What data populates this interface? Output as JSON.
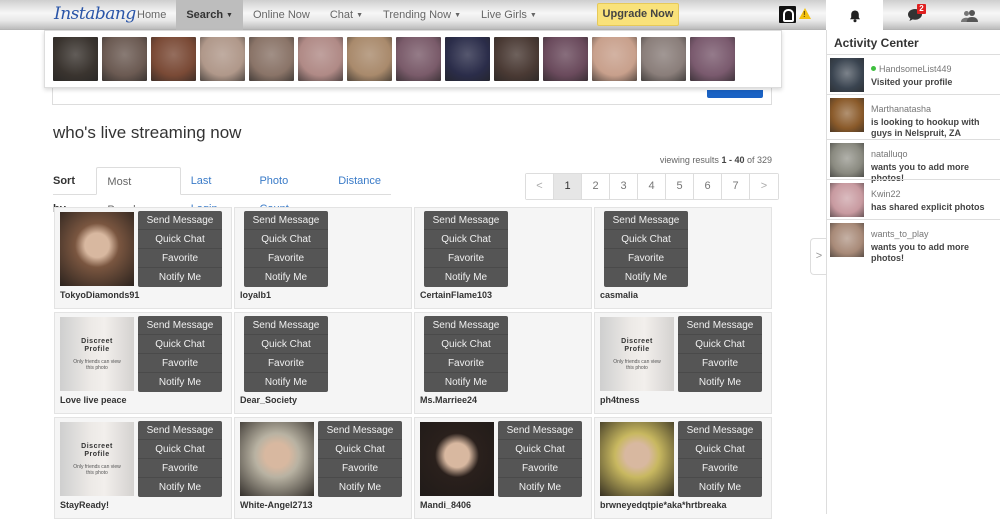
{
  "header": {
    "logo_text": "Instabang",
    "nav": [
      {
        "label": "Home",
        "dropdown": false,
        "active": false
      },
      {
        "label": "Search",
        "dropdown": true,
        "active": true
      },
      {
        "label": "Online Now",
        "dropdown": false,
        "active": false
      },
      {
        "label": "Chat",
        "dropdown": true,
        "active": false
      },
      {
        "label": "Trending Now",
        "dropdown": true,
        "active": false
      },
      {
        "label": "Live Girls",
        "dropdown": true,
        "active": false
      }
    ],
    "upgrade_label": "Upgrade Now",
    "warning_glyph": "!",
    "messages_badge": "2",
    "icons": [
      "profile-avatar-icon",
      "warning-icon",
      "bell-icon",
      "chat-bubble-icon",
      "friends-icon"
    ]
  },
  "photo_strip": {
    "colors": [
      "#3a342f",
      "#6b5a52",
      "#7a4a36",
      "#b0988a",
      "#8a7468",
      "#b08a86",
      "#a98a6c",
      "#7a5b6a",
      "#2b2d4a",
      "#4a3a34",
      "#6a4a5c",
      "#c8a08c",
      "#8a7e7a",
      "#7a5a6e"
    ]
  },
  "search": {
    "button_color": "#1a62c4"
  },
  "main": {
    "title": "who's live streaming now",
    "sort": {
      "label": "Sort by",
      "tabs": [
        {
          "label": "Most Popular",
          "active": true
        },
        {
          "label": "Last Login",
          "active": false
        },
        {
          "label": "Photo Count",
          "active": false
        },
        {
          "label": "Distance",
          "active": false
        }
      ]
    },
    "viewing": {
      "prefix": "viewing results ",
      "range": "1 - 40",
      "middle": " of ",
      "total": "329"
    },
    "pagination": {
      "prev": "<",
      "next": ">",
      "pages": [
        "1",
        "2",
        "3",
        "4",
        "5",
        "6",
        "7"
      ],
      "current": "1"
    },
    "discreet": {
      "title_line1": "Discreet",
      "title_line2": "Profile",
      "note": "Only friends can view this photo"
    },
    "actions": [
      "Send Message",
      "Quick Chat",
      "Favorite",
      "Notify Me"
    ],
    "members": [
      {
        "username": "TokyoDiamonds91",
        "photo": "photo",
        "color": "#7a5640"
      },
      {
        "username": "loyalb1",
        "photo": "none",
        "color": ""
      },
      {
        "username": "CertainFlame103",
        "photo": "none",
        "color": ""
      },
      {
        "username": "casmalia",
        "photo": "none",
        "color": ""
      },
      {
        "username": "Love live peace",
        "photo": "discreet",
        "color": ""
      },
      {
        "username": "Dear_Society",
        "photo": "none",
        "color": ""
      },
      {
        "username": "Ms.Marriee24",
        "photo": "none",
        "color": ""
      },
      {
        "username": "ph4tness",
        "photo": "discreet",
        "color": ""
      },
      {
        "username": "StayReady!",
        "photo": "discreet",
        "color": ""
      },
      {
        "username": "White-Angel2713",
        "photo": "photo",
        "color": "#b8b2a2"
      },
      {
        "username": "Mandi_8406",
        "photo": "photo",
        "color": "#2a201c"
      },
      {
        "username": "brwneyedqtpie*aka*hrtbreaka",
        "photo": "photo",
        "color": "#c8b860"
      }
    ]
  },
  "activity_center": {
    "title": "Activity Center",
    "items": [
      {
        "name": "HandsomeList449",
        "online": true,
        "message": "Visited your profile",
        "color": "#3a4450"
      },
      {
        "name": "Marthanatasha",
        "online": false,
        "message": "is looking to hookup with guys in Nelspruit, ZA",
        "color": "#8a5a2a"
      },
      {
        "name": "natalluqo",
        "online": false,
        "message": "wants you to add more photos!",
        "color": "#8a8a80"
      },
      {
        "name": "Kwin22",
        "online": false,
        "message": "has shared explicit photos",
        "color": "#c89aa0"
      },
      {
        "name": "wants_to_play",
        "online": false,
        "message": "wants you to add more photos!",
        "color": "#a88a78"
      }
    ],
    "collapse_glyph": ">"
  }
}
